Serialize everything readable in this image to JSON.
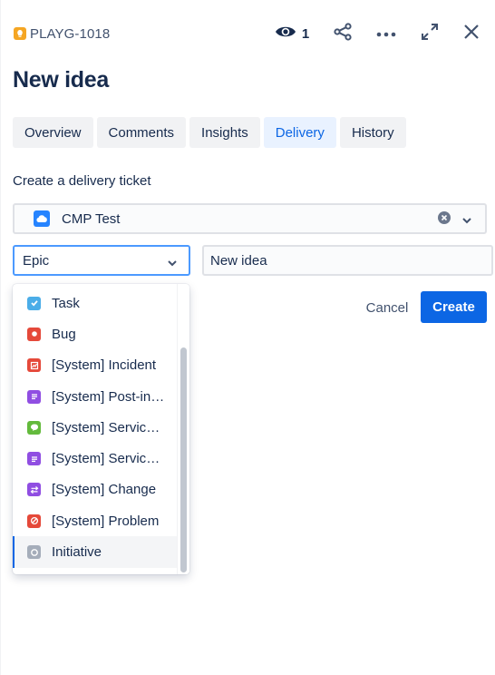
{
  "header": {
    "issue_key": "PLAYG-1018",
    "issue_icon": "lightbulb-icon",
    "watch_count": "1",
    "actions": [
      "eye-icon",
      "share-icon",
      "more-icon",
      "expand-icon",
      "close-icon"
    ]
  },
  "title": "New idea",
  "tabs": [
    {
      "label": "Overview",
      "active": false
    },
    {
      "label": "Comments",
      "active": false
    },
    {
      "label": "Insights",
      "active": false
    },
    {
      "label": "Delivery",
      "active": true
    },
    {
      "label": "History",
      "active": false
    }
  ],
  "delivery": {
    "section_label": "Create a delivery ticket",
    "project": {
      "value": "CMP Test",
      "icon": "cloud-project-icon"
    },
    "issue_type": {
      "value": "Epic"
    },
    "summary": {
      "value": "New idea"
    },
    "cancel_label": "Cancel",
    "create_label": "Create"
  },
  "issue_type_menu": {
    "items": [
      {
        "label": "Task",
        "icon": "task-icon",
        "color": "#4bade8"
      },
      {
        "label": "Bug",
        "icon": "bug-icon",
        "color": "#e5493a"
      },
      {
        "label": "[System] Incident",
        "icon": "incident-icon",
        "color": "#e5493a"
      },
      {
        "label": "[System] Post-incident review",
        "icon": "post-incident-icon",
        "color": "#904ee2"
      },
      {
        "label": "[System] Service request",
        "icon": "service-request-icon",
        "color": "#63ba3c"
      },
      {
        "label": "[System] Service request with approvals",
        "icon": "service-approval-icon",
        "color": "#904ee2"
      },
      {
        "label": "[System] Change",
        "icon": "change-icon",
        "color": "#904ee2"
      },
      {
        "label": "[System] Problem",
        "icon": "problem-icon",
        "color": "#e5493a"
      },
      {
        "label": "Initiative",
        "icon": "initiative-icon",
        "color": "#a5adba",
        "selected": true
      }
    ]
  },
  "colors": {
    "accent": "#0c66e4",
    "focus_border": "#4c9aff",
    "tab_bg": "#f1f2f4",
    "tab_active_bg": "#e9f2ff"
  }
}
